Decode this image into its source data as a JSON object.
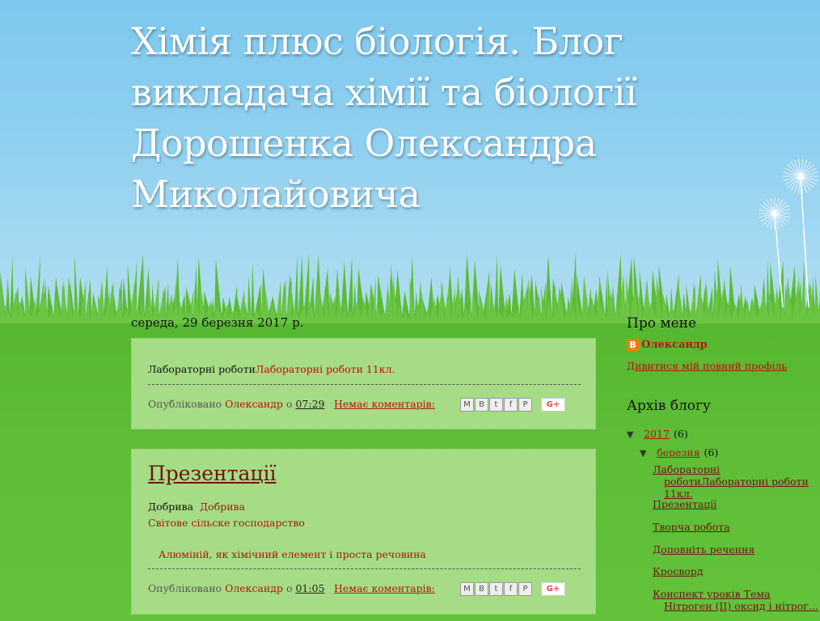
{
  "header": {
    "blog_title": "Хімія плюс біологія. Блог викладача хімії та біології Дорошенка Олександра Миколайовича"
  },
  "main": {
    "date_header": "середа, 29 березня 2017 р.",
    "posts": [
      {
        "body_text": "Лабораторні роботи",
        "body_link": "Лабораторні роботи 11кл.",
        "footer": {
          "published_label": "Опубліковано",
          "author": "Олександр",
          "at_label": "о",
          "time": "07:29",
          "comments": "Немає коментарів:"
        }
      },
      {
        "title": "Презентації",
        "line1_text": "Добрива",
        "line1_link": "Добрива",
        "line2_link": "Світове сільске господарство",
        "line3_link": "Алюміній, як хімічний елемент і проста речовина",
        "footer": {
          "published_label": "Опубліковано",
          "author": "Олександр",
          "at_label": "о",
          "time": "01:05",
          "comments": "Немає коментарів:"
        }
      }
    ],
    "share_icons": [
      "email-icon",
      "blogthis-icon",
      "twitter-icon",
      "facebook-icon",
      "pinterest-icon"
    ],
    "gplus_label": "G+"
  },
  "sidebar": {
    "about_title": "Про мене",
    "profile_name": "Олександр",
    "profile_link": "Дивитися мій повний профіль",
    "archive_title": "Архів блогу",
    "archive_toggle": "▼",
    "archive_year": "2017",
    "archive_year_count": "(6)",
    "archive_month": "березня",
    "archive_month_count": "(6)",
    "archive_posts": [
      "Лабораторні роботиЛабораторні роботи 11кл.",
      "Презентації",
      "Творча робота",
      "Доповніть речення",
      "Кросворд",
      "Конспект уроків Тема Нітроген (ІІ) оксид і нітрог..."
    ]
  },
  "colors": {
    "sky": "#8fd0f0",
    "grass": "#5dbd36",
    "post_bg": "#a6dc86",
    "link": "#b5120f",
    "post_title": "#6b1412"
  }
}
